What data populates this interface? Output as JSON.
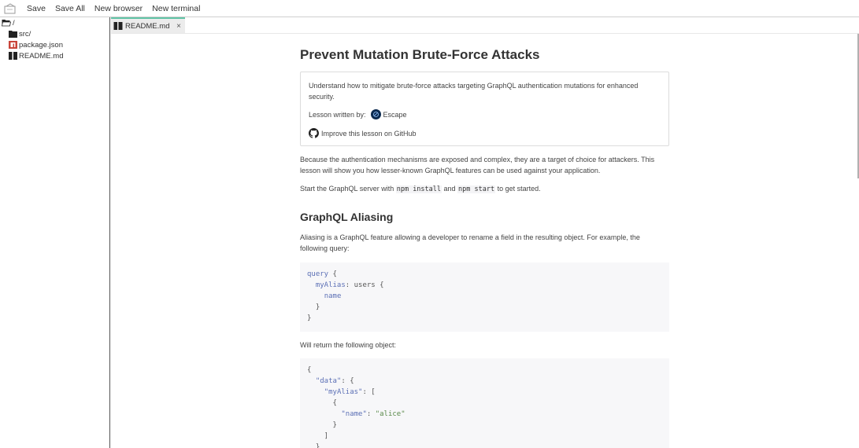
{
  "toolbar": {
    "buttons": [
      "Save",
      "Save All",
      "New browser",
      "New terminal"
    ]
  },
  "sidebar": {
    "root": "/",
    "items": [
      {
        "label": "src/",
        "icon": "folder-icon"
      },
      {
        "label": "package.json",
        "icon": "npm-icon"
      },
      {
        "label": "README.md",
        "icon": "markdown-icon"
      }
    ]
  },
  "editor": {
    "tab": {
      "label": "README.md",
      "close": "×"
    }
  },
  "article": {
    "title": "Prevent Mutation Brute-Force Attacks",
    "card": {
      "description": "Understand how to mitigate brute-force attacks targeting GraphQL authentication mutations for enhanced security.",
      "author_label": "Lesson written by:",
      "author_name": "Escape",
      "github_link": "Improve this lesson on GitHub"
    },
    "para1": "Because the authentication mechanisms are exposed and complex, they are a target of choice for attackers. This lesson will show you how lesser-known GraphQL features can be used against your application.",
    "para2": {
      "before": "Start the GraphQL server with ",
      "code1": "npm install",
      "middle": " and ",
      "code2": "npm start",
      "after": " to get started."
    },
    "h2": "GraphQL Aliasing",
    "para3": "Aliasing is a GraphQL feature allowing a developer to rename a field in the resulting object. For example, the following query:",
    "code1": {
      "kw_query": "query",
      "alias": "myAlias",
      "field": "users",
      "name": "name"
    },
    "para4": "Will return the following object:",
    "code2": {
      "data_key": "\"data\"",
      "alias_key": "\"myAlias\"",
      "name_key": "\"name\"",
      "name_value": "\"alice\""
    }
  },
  "colors": {
    "accent": "#5fc3a6"
  }
}
